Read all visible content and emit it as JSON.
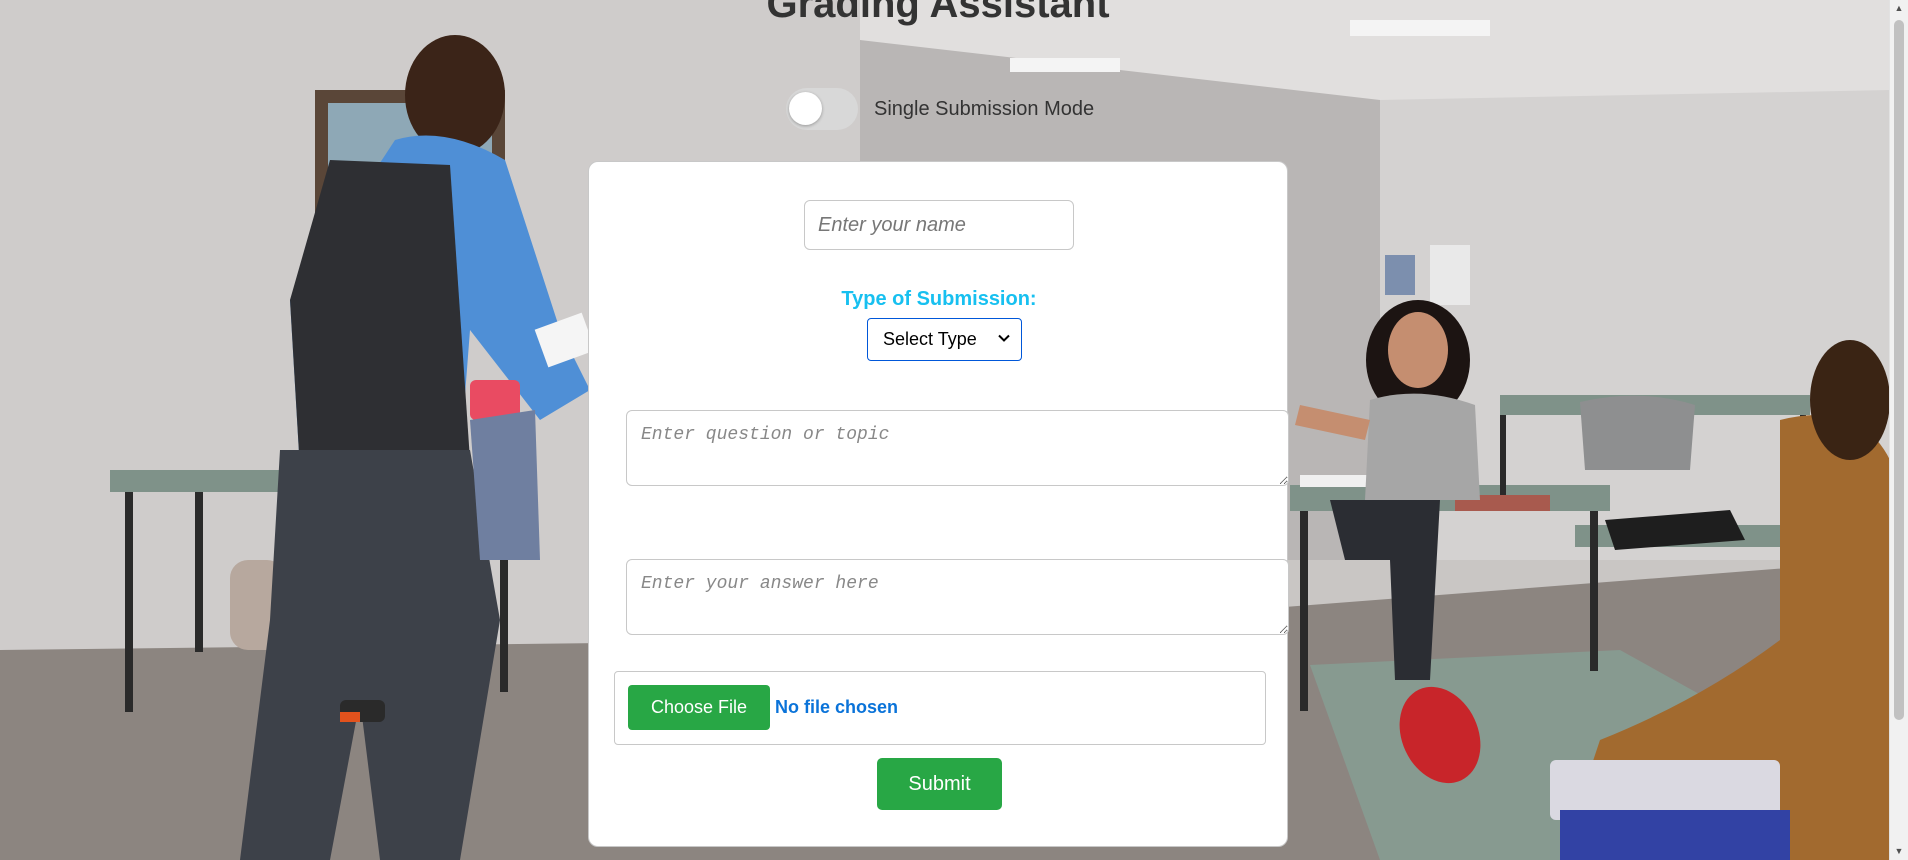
{
  "app": {
    "title": "Grading Assistant"
  },
  "mode_toggle": {
    "label": "Single Submission Mode",
    "enabled": false
  },
  "form": {
    "name_placeholder": "Enter your name",
    "name_value": "",
    "type_label": "Type of Submission:",
    "type_selected": "Select Type",
    "question_placeholder": "Enter question or topic",
    "answer_placeholder": "Enter your answer here",
    "choose_file_label": "Choose File",
    "file_status": "No file chosen",
    "submit_label": "Submit"
  },
  "colors": {
    "accent_green": "#28a745",
    "label_cyan": "#17c0f0",
    "file_status_blue": "#0a73d9",
    "select_border": "#0057d9"
  }
}
